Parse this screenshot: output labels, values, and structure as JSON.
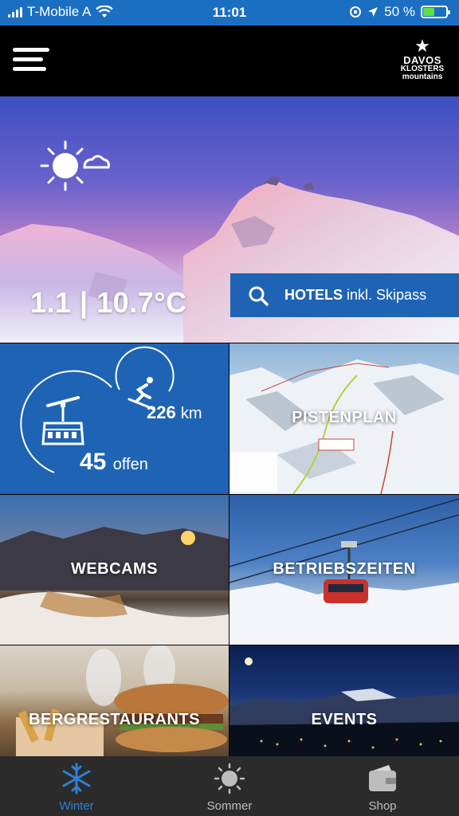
{
  "status_bar": {
    "carrier": "T-Mobile A",
    "time": "11:01",
    "battery_percent": "50 %",
    "battery_level": 0.5
  },
  "header": {
    "logo_line1": "DAVOS",
    "logo_line2": "KLOSTERS",
    "logo_line3": "mountains"
  },
  "hero": {
    "temperature": "1.1 | 10.7°C",
    "hotels_bold": "HOTELS",
    "hotels_rest": "inkl. Skipass"
  },
  "status_tile": {
    "lifts_value": "45",
    "lifts_unit": "offen",
    "slopes_value": "226",
    "slopes_unit": "km"
  },
  "tiles": {
    "pistenplan": "PISTENPLAN",
    "webcams": "WEBCAMS",
    "betriebszeiten": "BETRIEBSZEITEN",
    "bergrestaurants": "BERGRESTAURANTS",
    "events": "EVENTS"
  },
  "tabbar": {
    "tabs": [
      {
        "label": "Winter",
        "icon": "snowflake-icon",
        "active": true
      },
      {
        "label": "Sommer",
        "icon": "sun-icon",
        "active": false
      },
      {
        "label": "Shop",
        "icon": "wallet-icon",
        "active": false
      }
    ]
  },
  "colors": {
    "brand_blue": "#1f63b4",
    "status_bar_blue": "#1b6fc2",
    "tab_active": "#2f7fd4",
    "battery_green": "#5ee04a"
  }
}
